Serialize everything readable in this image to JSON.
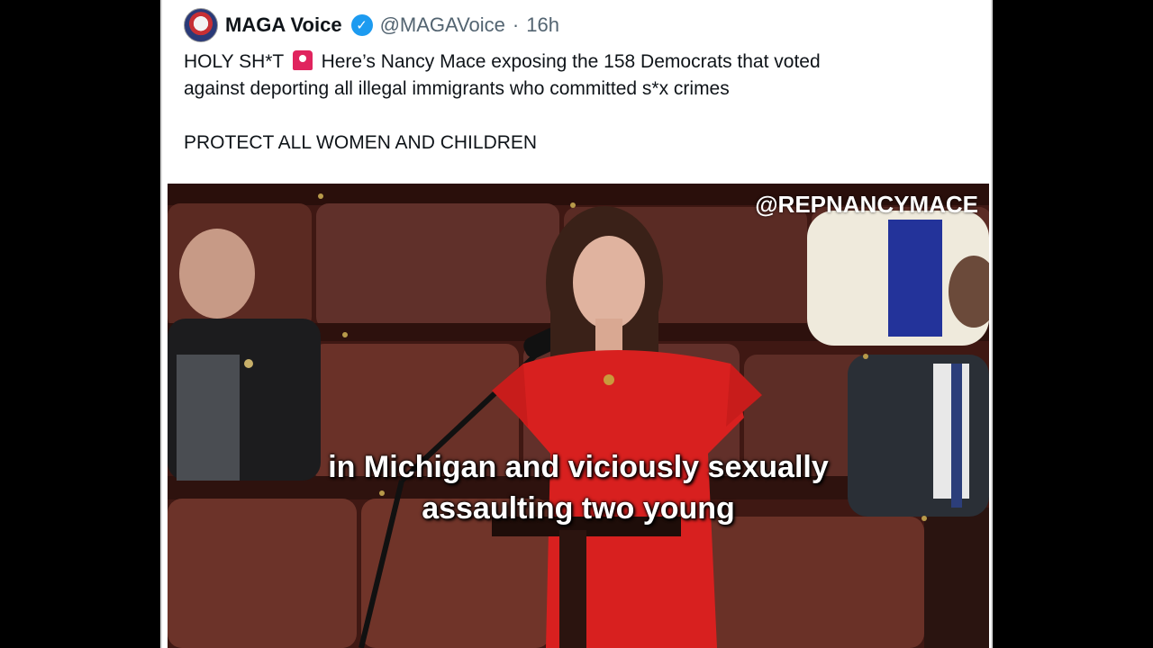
{
  "tweet": {
    "display_name": "MAGA Voice",
    "handle": "@MAGAVoice",
    "separator": "·",
    "time": "16h",
    "verified": true,
    "text_part1": "HOLY SH*T",
    "text_icon": "rotating-light-siren-icon",
    "text_part2": "Here’s Nancy Mace exposing the 158 Democrats that voted",
    "text_line2": "against deporting all illegal immigrants who committed s*x crimes",
    "text_line3": "PROTECT ALL WOMEN AND CHILDREN"
  },
  "video": {
    "watermark": "@REPNANCYMACE",
    "caption_line1": "in Michigan and viciously sexually",
    "caption_line2": "assaulting two young"
  },
  "colors": {
    "background": "#000000",
    "card": "#ffffff",
    "verified": "#1d9bf0",
    "siren": "#e0245e",
    "dress": "#d8201f"
  }
}
